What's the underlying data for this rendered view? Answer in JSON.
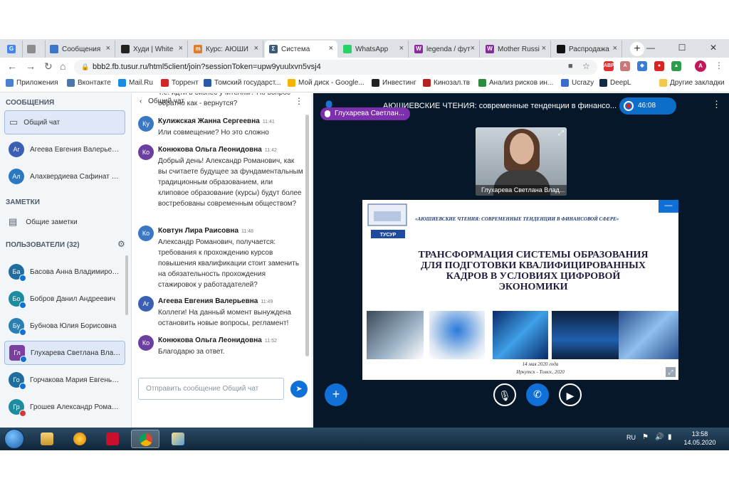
{
  "browser": {
    "tabs": [
      {
        "label": "",
        "icon": "google-icon",
        "color": "#4285f4",
        "letter": "G"
      },
      {
        "label": "",
        "icon": "globe-icon",
        "color": "#8d8d8d",
        "letter": ""
      },
      {
        "label": "Сообщения",
        "icon": "chat-icon",
        "color": "#3b77c7",
        "letter": ""
      },
      {
        "label": "Худи | White",
        "icon": "brand-icon",
        "color": "#222222",
        "letter": ""
      },
      {
        "label": "Курс: АЮШИ",
        "icon": "course-icon",
        "color": "#e07b2a",
        "letter": "m"
      },
      {
        "label": "Система",
        "icon": "system-icon",
        "color": "#3c5b7c",
        "letter": "Σ"
      },
      {
        "label": "WhatsApp",
        "icon": "whatsapp-icon",
        "color": "#25d366",
        "letter": ""
      },
      {
        "label": "legenda / фут",
        "icon": "w-icon",
        "color": "#8a2b9c",
        "letter": "W"
      },
      {
        "label": "Mother Russi",
        "icon": "w-icon",
        "color": "#8a2b9c",
        "letter": "W"
      },
      {
        "label": "Распродажа",
        "icon": "sale-icon",
        "color": "#111111",
        "letter": ""
      }
    ],
    "url": "bbb2.fb.tusur.ru/html5client/join?sessionToken=upw9yuulxvn5vsj4",
    "bookmarks": [
      {
        "label": "Приложения",
        "color": "#4a7fd1"
      },
      {
        "label": "Вконтакте",
        "color": "#4a76a8"
      },
      {
        "label": "Mail.Ru",
        "color": "#168de2"
      },
      {
        "label": "Торрент",
        "color": "#d12727"
      },
      {
        "label": "Томский государст...",
        "color": "#2a5aa5"
      },
      {
        "label": "Мой диск - Google...",
        "color": "#f4b400"
      },
      {
        "label": "Инвестинг",
        "color": "#222222"
      },
      {
        "label": "Кинозал.тв",
        "color": "#b52020"
      },
      {
        "label": "Анализ рисков ин...",
        "color": "#2d8a3e"
      },
      {
        "label": "Ucrazy",
        "color": "#3a6cc9"
      },
      {
        "label": "DeepL",
        "color": "#0f2b46"
      },
      {
        "label": "Другие закладки",
        "color": "#f2c94c"
      }
    ]
  },
  "sidebar": {
    "messages_header": "СООБЩЕНИЯ",
    "public_chat": "Общий чат",
    "private_chats": [
      {
        "initials": "Ar",
        "name": "Агеева Евгения Валерьевна",
        "color": "#3a5fb3"
      },
      {
        "initials": "Ал",
        "name": "Алахвердиева Сафинат Вяч...",
        "color": "#2b78c2"
      }
    ],
    "notes_header": "ЗАМЕТКИ",
    "shared_notes": "Общие заметки",
    "users_header": "ПОЛЬЗОВАТЕЛИ (32)",
    "users": [
      {
        "initials": "Ба",
        "name": "Басова Анна Владимировна",
        "color": "#1f6c9e",
        "mic": "on"
      },
      {
        "initials": "Бо",
        "name": "Бобров Данил Андреевич",
        "color": "#1d8ba0",
        "mic": "on"
      },
      {
        "initials": "Бу",
        "name": "Бубнова Юлия Борисовна",
        "color": "#2a7fb4",
        "mic": "on"
      },
      {
        "initials": "Гл",
        "name": "Глухарева Светлана Влади...",
        "color": "#7a3fa0",
        "mic": "on"
      },
      {
        "initials": "Го",
        "name": "Горчакова Мария Евгеньевна",
        "color": "#1f6c9e",
        "mic": "on"
      },
      {
        "initials": "Гр",
        "name": "Грошев Александр Романов...",
        "color": "#1d8ba0",
        "mic": "muted"
      }
    ]
  },
  "chat": {
    "back_label": "Общий чат",
    "input_placeholder": "Отправить сообщение Общий чат",
    "messages": [
      {
        "initials": "",
        "author": "",
        "time": "",
        "color": "#6b3fa0",
        "text": "Т.е. идти в бизнес учителям? Но вопрос - обратно как - вернутся?"
      },
      {
        "initials": "Ку",
        "author": "Кулижская Жанна Сергеевна",
        "time": "11:41",
        "color": "#3a77c4",
        "text": "Или совмещение? Но это сложно"
      },
      {
        "initials": "Ко",
        "author": "Конюкова Ольга Леонидовна",
        "time": "11:42",
        "color": "#6b3fa0",
        "text": "Добрый день! Александр Романович, как вы считаете будущее за фундаментальным традиционным образованием, или клиповое образование (курсы) будут более востребованы современным обществом?"
      },
      {
        "initials": "Ко",
        "author": "Ковтун Лира Раисовна",
        "time": "11:48",
        "color": "#3a77c4",
        "text": "Александр Романович, получается: требования к прохождению курсов повышения квалификации стоит заменить на обязательность прохождения стажировок у работадателей?"
      },
      {
        "initials": "Ar",
        "author": "Агеева Евгения Валерьевна",
        "time": "11:49",
        "color": "#3a5fb3",
        "text": "Коллеги! На данный момент вынуждена остановить новые вопросы, регламент!"
      },
      {
        "initials": "Ко",
        "author": "Конюкова Ольга Леонидовна",
        "time": "11:52",
        "color": "#6b3fa0",
        "text": "Благодарю за ответ."
      }
    ]
  },
  "stage": {
    "title": "АЮШИЕВСКИЕ ЧТЕНИЯ: современные тенденции в финансо...",
    "timer": "46:08",
    "talking": "Глухарева Светлан...",
    "webcam_name": "Глухарева Светлана Влад...",
    "slide": {
      "header": "«АЮШИЕВСКИЕ ЧТЕНИЯ: СОВРЕМЕННЫЕ ТЕНДЕНЦИИ В ФИНАНСОВОЙ СФЕРЕ»",
      "title_lines": [
        "ТРАНСФОРМАЦИЯ СИСТЕМЫ ОБРАЗОВАНИЯ",
        "ДЛЯ ПОДГОТОВКИ КВАЛИФИЦИРОВАННЫХ",
        "КАДРОВ В УСЛОВИЯХ ЦИФРОВОЙ",
        "ЭКОНОМИКИ"
      ],
      "date": "14 мая 2020 года",
      "place": "Иркутск - Томск, 2020",
      "logo_text": "ТУСУР"
    }
  },
  "taskbar": {
    "lang": "RU",
    "time": "13:58",
    "date": "14.05.2020"
  }
}
